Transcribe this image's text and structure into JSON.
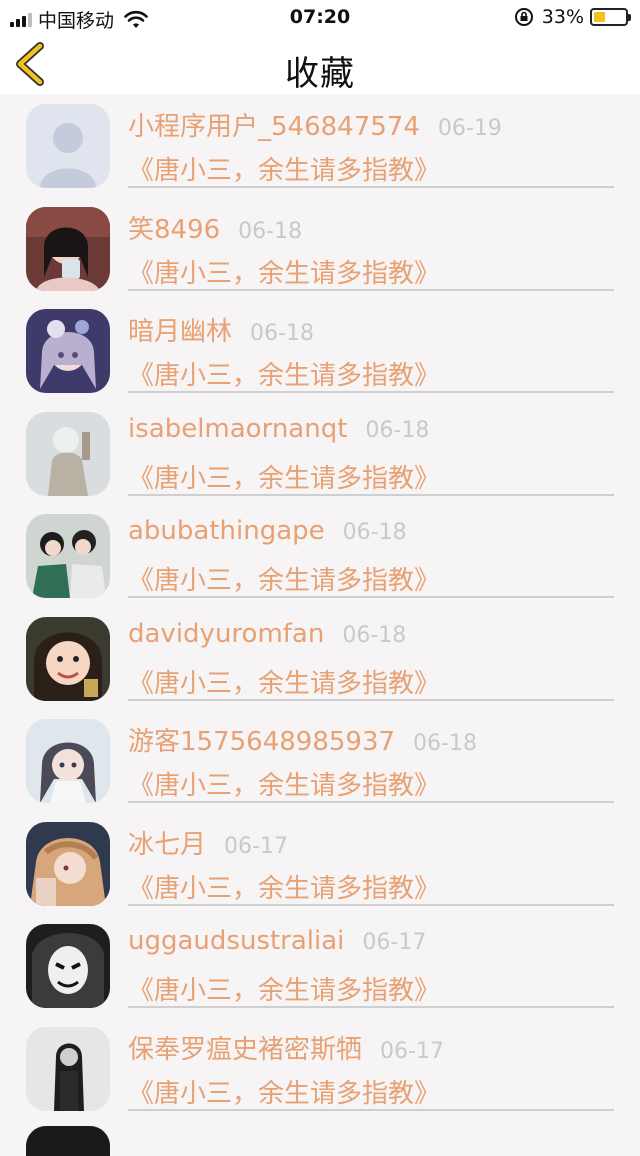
{
  "status_bar": {
    "carrier": "中国移动",
    "time": "07:20",
    "battery": "33%"
  },
  "nav": {
    "title": "收藏"
  },
  "items": [
    {
      "username": "小程序用户_546847574",
      "date": "06-19",
      "book": "《唐小三，余生请多指教》"
    },
    {
      "username": "笑8496",
      "date": "06-18",
      "book": "《唐小三，余生请多指教》"
    },
    {
      "username": "暗月幽林",
      "date": "06-18",
      "book": "《唐小三，余生请多指教》"
    },
    {
      "username": "isabelmaornanqt",
      "date": "06-18",
      "book": "《唐小三，余生请多指教》"
    },
    {
      "username": "abubathingape",
      "date": "06-18",
      "book": "《唐小三，余生请多指教》"
    },
    {
      "username": "davidyuromfan",
      "date": "06-18",
      "book": "《唐小三，余生请多指教》"
    },
    {
      "username": "游客1575648985937",
      "date": "06-18",
      "book": "《唐小三，余生请多指教》"
    },
    {
      "username": "冰七月",
      "date": "06-17",
      "book": "《唐小三，余生请多指教》"
    },
    {
      "username": "uggaudsustraliai",
      "date": "06-17",
      "book": "《唐小三，余生请多指教》"
    },
    {
      "username": "保奉罗瘟史褚密斯牺",
      "date": "06-17",
      "book": "《唐小三，余生请多指教》"
    }
  ],
  "colors": {
    "accent": "#e8a173",
    "date": "#c9c9c9",
    "back_arrow": "#f3c21b"
  }
}
